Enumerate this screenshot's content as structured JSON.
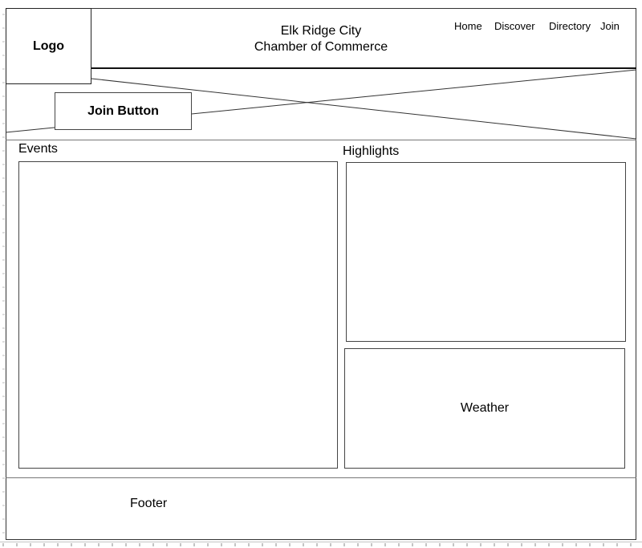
{
  "header": {
    "logo_label": "Logo",
    "title_line1": "Elk Ridge City",
    "title_line2": "Chamber of Commerce",
    "nav": [
      "Home",
      "Discover",
      "Directory",
      "Join"
    ]
  },
  "hero": {
    "join_button_label": "Join Button"
  },
  "main": {
    "events_heading": "Events",
    "highlights_heading": "Highlights",
    "weather_label": "Weather"
  },
  "footer": {
    "label": "Footer"
  }
}
